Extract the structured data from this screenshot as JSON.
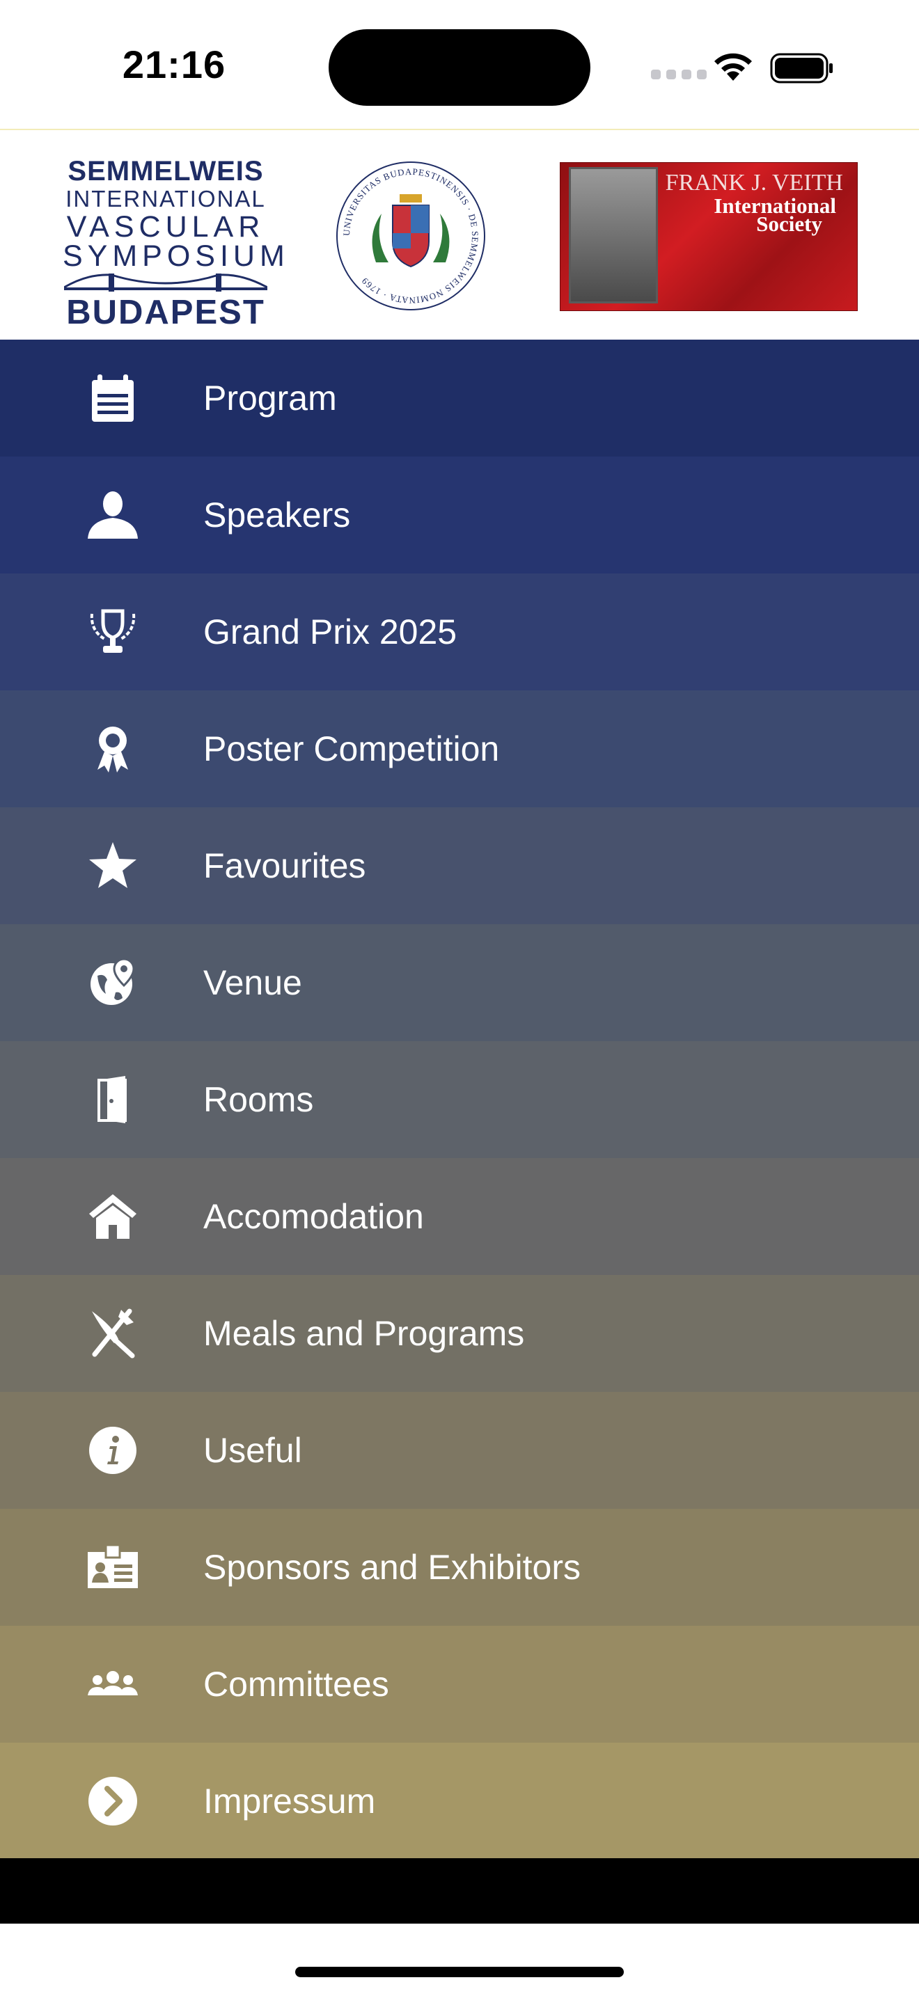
{
  "status_bar": {
    "time": "21:16"
  },
  "logos": {
    "sivs": {
      "line1": "SEMMELWEIS",
      "line2": "INTERNATIONAL",
      "line3": "VASCULAR",
      "line4": "SYMPOSIUM",
      "line5": "BUDAPEST"
    },
    "university_seal": {
      "text": "UNIVERSITAS BUDAPESTINENSIS · DE SEMMELWEIS NOMINATA · 1769"
    },
    "veith": {
      "line1": "FRANK J. VEITH",
      "line2": "International",
      "line3": "Society"
    }
  },
  "menu": {
    "items": [
      {
        "label": "Program",
        "icon": "calendar-icon",
        "bg": "#1f2e66"
      },
      {
        "label": "Speakers",
        "icon": "person-icon",
        "bg": "#263570"
      },
      {
        "label": "Grand Prix 2025",
        "icon": "trophy-icon",
        "bg": "#313f72"
      },
      {
        "label": "Poster Competition",
        "icon": "award-ribbon-icon",
        "bg": "#3c4a70"
      },
      {
        "label": "Favourites",
        "icon": "star-icon",
        "bg": "#48526d"
      },
      {
        "label": "Venue",
        "icon": "globe-location-icon",
        "bg": "#525b6b"
      },
      {
        "label": "Rooms",
        "icon": "door-icon",
        "bg": "#5d626a"
      },
      {
        "label": "Accomodation",
        "icon": "house-icon",
        "bg": "#676768"
      },
      {
        "label": "Meals and Programs",
        "icon": "fork-knife-icon",
        "bg": "#737065"
      },
      {
        "label": "Useful",
        "icon": "info-icon",
        "bg": "#7e7763"
      },
      {
        "label": "Sponsors and Exhibitors",
        "icon": "id-badge-icon",
        "bg": "#8a8061"
      },
      {
        "label": "Committees",
        "icon": "users-group-icon",
        "bg": "#988b63"
      },
      {
        "label": "Impressum",
        "icon": "chevron-right-circle-icon",
        "bg": "#a59766"
      }
    ]
  }
}
